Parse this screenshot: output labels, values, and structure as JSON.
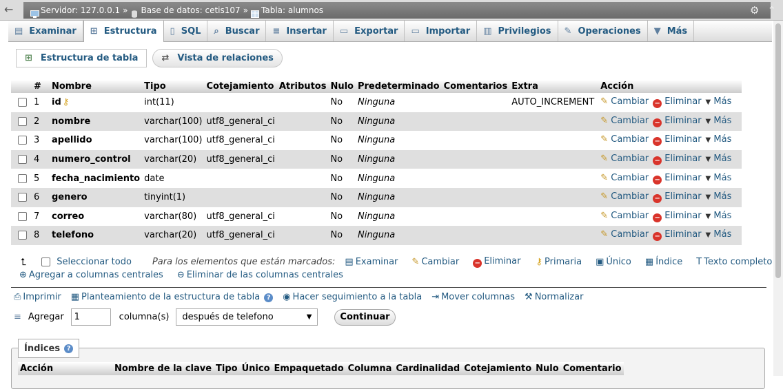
{
  "breadcrumb": {
    "server_label": "Servidor: 127.0.0.1",
    "database_label": "Base de datos: cetis107",
    "table_label": "Tabla: alumnos",
    "separator": "»"
  },
  "tabs": [
    {
      "label": "Examinar",
      "icon": "browse-icon",
      "glyph": "▤"
    },
    {
      "label": "Estructura",
      "icon": "structure-icon",
      "glyph": "⊞",
      "active": true
    },
    {
      "label": "SQL",
      "icon": "sql-icon",
      "glyph": "▯"
    },
    {
      "label": "Buscar",
      "icon": "search-icon",
      "glyph": "⌕"
    },
    {
      "label": "Insertar",
      "icon": "insert-icon",
      "glyph": "≡"
    },
    {
      "label": "Exportar",
      "icon": "export-icon",
      "glyph": "▭"
    },
    {
      "label": "Importar",
      "icon": "import-icon",
      "glyph": "▭"
    },
    {
      "label": "Privilegios",
      "icon": "privileges-icon",
      "glyph": "▥"
    },
    {
      "label": "Operaciones",
      "icon": "wrench-icon",
      "glyph": "✎"
    },
    {
      "label": "Más",
      "icon": "caret-down-icon",
      "glyph": "▼"
    }
  ],
  "subnav": {
    "structure_label": "Estructura de tabla",
    "relations_label": "Vista de relaciones"
  },
  "columns_header": [
    "#",
    "Nombre",
    "Tipo",
    "Cotejamiento",
    "Atributos",
    "Nulo",
    "Predeterminado",
    "Comentarios",
    "Extra",
    "Acción"
  ],
  "rows": [
    {
      "num": "1",
      "name": "id",
      "type": "int(11)",
      "collation": "",
      "attributes": "",
      "null": "No",
      "default": "Ninguna",
      "comments": "",
      "extra": "AUTO_INCREMENT",
      "primary": true
    },
    {
      "num": "2",
      "name": "nombre",
      "type": "varchar(100)",
      "collation": "utf8_general_ci",
      "attributes": "",
      "null": "No",
      "default": "Ninguna",
      "comments": "",
      "extra": ""
    },
    {
      "num": "3",
      "name": "apellido",
      "type": "varchar(100)",
      "collation": "utf8_general_ci",
      "attributes": "",
      "null": "No",
      "default": "Ninguna",
      "comments": "",
      "extra": ""
    },
    {
      "num": "4",
      "name": "numero_control",
      "type": "varchar(20)",
      "collation": "utf8_general_ci",
      "attributes": "",
      "null": "No",
      "default": "Ninguna",
      "comments": "",
      "extra": ""
    },
    {
      "num": "5",
      "name": "fecha_nacimiento",
      "type": "date",
      "collation": "",
      "attributes": "",
      "null": "No",
      "default": "Ninguna",
      "comments": "",
      "extra": ""
    },
    {
      "num": "6",
      "name": "genero",
      "type": "tinyint(1)",
      "collation": "",
      "attributes": "",
      "null": "No",
      "default": "Ninguna",
      "comments": "",
      "extra": ""
    },
    {
      "num": "7",
      "name": "correo",
      "type": "varchar(80)",
      "collation": "utf8_general_ci",
      "attributes": "",
      "null": "No",
      "default": "Ninguna",
      "comments": "",
      "extra": ""
    },
    {
      "num": "8",
      "name": "telefono",
      "type": "varchar(20)",
      "collation": "utf8_general_ci",
      "attributes": "",
      "null": "No",
      "default": "Ninguna",
      "comments": "",
      "extra": ""
    }
  ],
  "row_actions": {
    "change": "Cambiar",
    "drop": "Eliminar",
    "more": "Más"
  },
  "bulk": {
    "select_all": "Seleccionar todo",
    "with_selected": "Para los elementos que están marcados:",
    "browse": "Examinar",
    "change": "Cambiar",
    "drop": "Eliminar",
    "primary": "Primaria",
    "unique": "Único",
    "index": "Índice",
    "fulltext": "Texto completo",
    "add_central": "Agregar a columnas centrales",
    "remove_central": "Eliminar de las columnas centrales"
  },
  "tools": {
    "print": "Imprimir",
    "propose": "Planteamiento de la estructura de tabla",
    "track": "Hacer seguimiento a la tabla",
    "move": "Mover columnas",
    "normalize": "Normalizar"
  },
  "add_columns": {
    "label": "Agregar",
    "count": "1",
    "unit_label": "columna(s)",
    "position": "después de telefono",
    "submit": "Continuar"
  },
  "indexes": {
    "legend": "Índices",
    "headers": [
      "Acción",
      "Nombre de la clave",
      "Tipo",
      "Único",
      "Empaquetado",
      "Columna",
      "Cardinalidad",
      "Cotejamiento",
      "Nulo",
      "Comentario"
    ]
  },
  "colors": {
    "link": "#235a81",
    "topbar": "#7a7a7a",
    "row_alt": "#dfdfdf"
  }
}
